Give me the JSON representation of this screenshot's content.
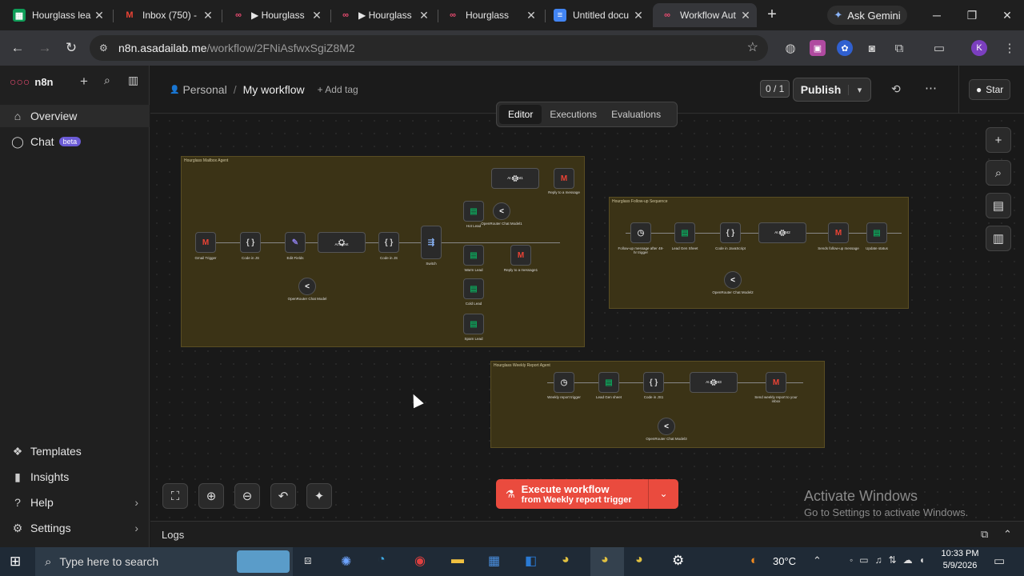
{
  "browser": {
    "tabs": [
      {
        "label": "Hourglass lea",
        "icon": "sheets-icon",
        "color": "#0f9d58"
      },
      {
        "label": "Inbox (750) -",
        "icon": "gmail-icon",
        "color": "#ea4335"
      },
      {
        "label": "▶ Hourglass",
        "icon": "n8n-icon",
        "color": "#ea4b71"
      },
      {
        "label": "▶ Hourglass",
        "icon": "n8n-icon",
        "color": "#ea4b71"
      },
      {
        "label": "Hourglass",
        "icon": "n8n-icon",
        "color": "#ea4b71"
      },
      {
        "label": "Untitled docu",
        "icon": "docs-icon",
        "color": "#4285f4"
      },
      {
        "label": "Workflow Aut",
        "icon": "n8n-icon",
        "color": "#ea4b71"
      }
    ],
    "ask_gemini": "Ask Gemini",
    "url_host": "n8n.asadailab.me",
    "url_path": "/workflow/2FNiAsfwxSgiZ8M2"
  },
  "sidebar": {
    "logo": "n8n",
    "items": [
      {
        "label": "Overview",
        "icon": "home-icon"
      },
      {
        "label": "Chat",
        "icon": "chat-icon",
        "badge": "beta"
      }
    ],
    "bottom": [
      {
        "label": "Templates",
        "icon": "templates-icon"
      },
      {
        "label": "Insights",
        "icon": "insights-icon"
      },
      {
        "label": "Help",
        "icon": "help-icon"
      },
      {
        "label": "Settings",
        "icon": "settings-icon"
      }
    ]
  },
  "header": {
    "breadcrumb_owner": "Personal",
    "breadcrumb_sep": "/",
    "workflow_name": "My workflow",
    "add_tag": "+ Add tag",
    "counter": "0 / 1",
    "publish": "Publish",
    "star": "Star",
    "tabs": [
      "Editor",
      "Executions",
      "Evaluations"
    ]
  },
  "canvas": {
    "groups": [
      {
        "title": "Hourglass Mailbox Agent",
        "nodes": [
          "Gmail Trigger",
          "Code in JS",
          "Edit Fields",
          "AI Agent",
          "Code in JS",
          "Switch",
          "Hot Lead",
          "Warm Lead",
          "Cold Lead",
          "Spam Lead",
          "AI Agent1",
          "Reply to a message",
          "Reply to a message1",
          "OpenRouter Chat Model",
          "OpenRouter Chat Model1"
        ]
      },
      {
        "title": "Hourglass Follow-up Sequence",
        "nodes": [
          "Follow-up message after 48-hr trigger",
          "Lead Gen Sheet",
          "Code in JavaScript",
          "AI Agent2",
          "Sends follow-up message",
          "Update status",
          "OpenRouter Chat Model2"
        ]
      },
      {
        "title": "Hourglass Weekly Report Agent",
        "nodes": [
          "Weekly report trigger",
          "Lead Gen sheet",
          "Code in JS1",
          "AI Agent3",
          "Send weekly report to your inbox",
          "OpenRouter Chat Model3"
        ]
      }
    ],
    "execute": "Execute workflow",
    "execute_sub": "from Weekly report trigger",
    "watermark_title": "Activate Windows",
    "watermark_sub": "Go to Settings to activate Windows."
  },
  "logs": "Logs",
  "taskbar": {
    "search_placeholder": "Type here to search",
    "temp": "30°C",
    "time": "10:33 PM",
    "date": "5/9/2026"
  }
}
